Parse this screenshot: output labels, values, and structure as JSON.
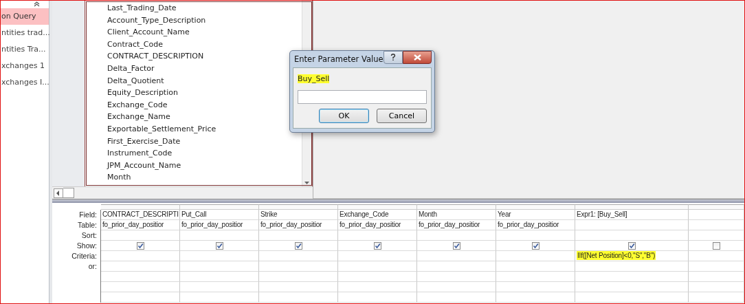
{
  "nav_pane": {
    "items": [
      {
        "label": "on Query",
        "selected": true
      },
      {
        "label": "ntities trad...",
        "selected": false
      },
      {
        "label": "ntities Tra...",
        "selected": false
      },
      {
        "label": "xchanges 1",
        "selected": false
      },
      {
        "label": "xchanges I...",
        "selected": false
      }
    ]
  },
  "field_list": {
    "fields": [
      "Last_Trading_Date",
      "Account_Type_Description",
      "Client_Account_Name",
      "Contract_Code",
      "CONTRACT_DESCRIPTION",
      "Delta_Factor",
      "Delta_Quotient",
      "Equity_Description",
      "Exchange_Code",
      "Exchange_Name",
      "Exportable_Settlement_Price",
      "First_Exercise_Date",
      "Instrument_Code",
      "JPM_Account_Name",
      "Month"
    ]
  },
  "dialog": {
    "title": "Enter Parameter Value",
    "prompt": "Buy_Sell",
    "prompt_highlighted": true,
    "buttons": [
      "OK",
      "Cancel"
    ]
  },
  "design_grid": {
    "row_labels": [
      "Field:",
      "Table:",
      "Sort:",
      "Show:",
      "Criteria:",
      "or:"
    ],
    "columns": [
      {
        "field": "CONTRACT_DESCRIPTI",
        "table": "fo_prior_day_positior",
        "show": true
      },
      {
        "field": "Put_Call",
        "table": "fo_prior_day_positior",
        "show": true
      },
      {
        "field": "Strike",
        "table": "fo_prior_day_positior",
        "show": true
      },
      {
        "field": "Exchange_Code",
        "table": "fo_prior_day_positior",
        "show": true
      },
      {
        "field": "Month",
        "table": "fo_prior_day_positior",
        "show": true
      },
      {
        "field": "Year",
        "table": "fo_prior_day_positior",
        "show": true
      },
      {
        "field": "Expr1: [Buy_Sell]",
        "show": true,
        "criteria": "IIf([Net Position]<0,\"S\",\"B\")",
        "criteria_highlighted": true
      },
      {
        "show": false
      }
    ]
  }
}
